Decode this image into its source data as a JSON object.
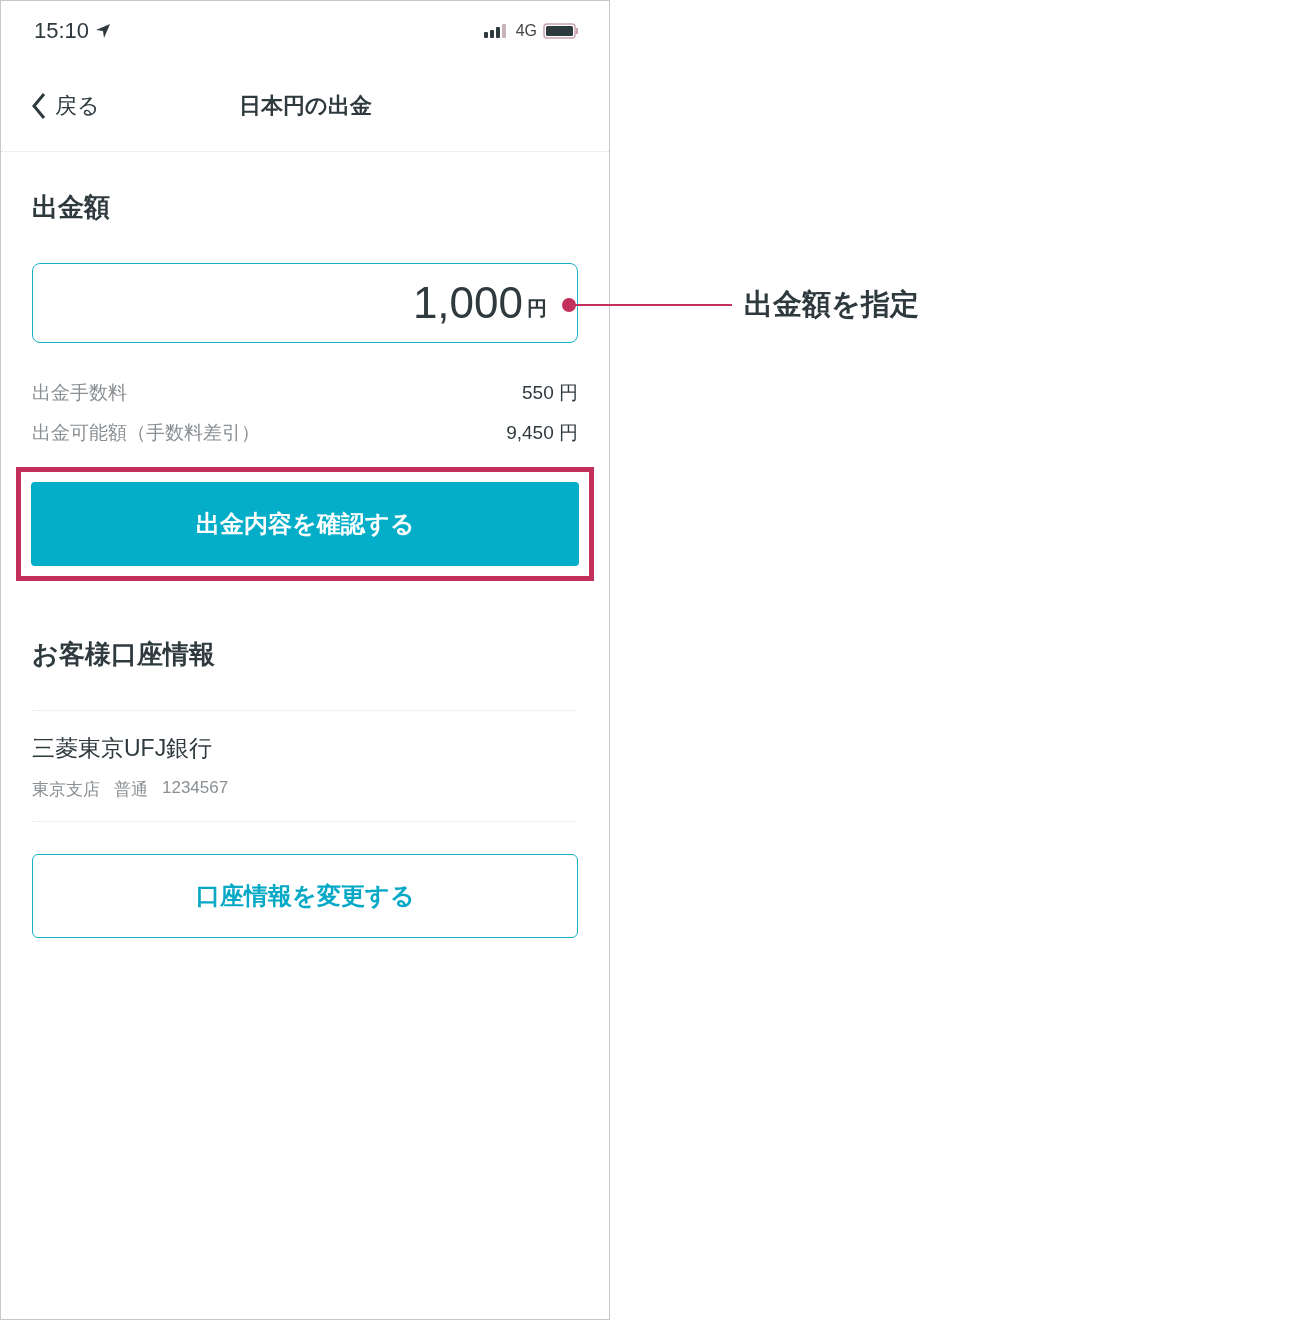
{
  "status_bar": {
    "time": "15:10",
    "network": "4G"
  },
  "nav": {
    "back": "戻る",
    "title": "日本円の出金"
  },
  "amount_section": {
    "heading": "出金額",
    "value": "1,000",
    "unit": "円"
  },
  "fees": [
    {
      "label": "出金手数料",
      "value": "550 円"
    },
    {
      "label": "出金可能額（手数料差引）",
      "value": "9,450 円"
    }
  ],
  "confirm_button": {
    "label": "出金内容を確認する",
    "highlighted": true
  },
  "account": {
    "heading": "お客様口座情報",
    "bank": "三菱東京UFJ銀行",
    "details": [
      "東京支店",
      "普通",
      "1234567"
    ]
  },
  "change_button": {
    "label": "口座情報を変更する"
  },
  "annotation": {
    "label": "出金額を指定"
  }
}
